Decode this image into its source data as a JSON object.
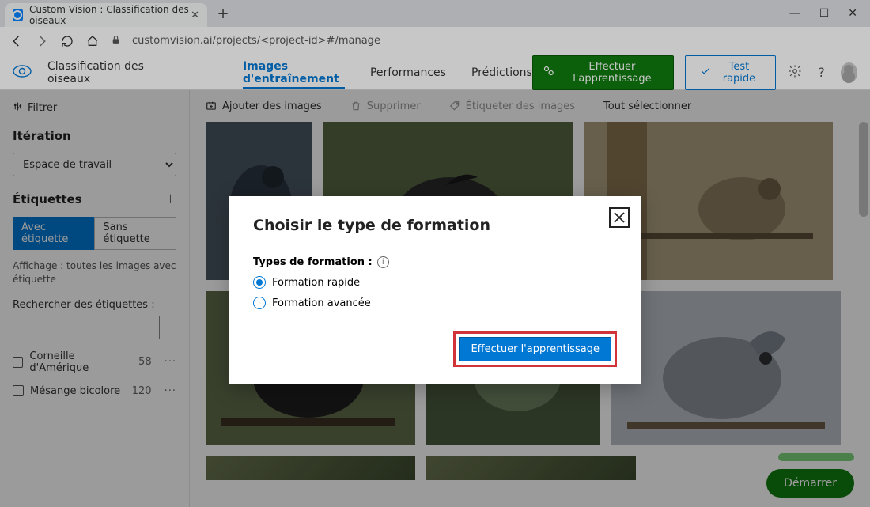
{
  "browser": {
    "tab_title": "Custom Vision : Classification des oiseaux",
    "url": "customvision.ai/projects/<project-id>#/manage"
  },
  "header": {
    "project_title": "Classification des oiseaux",
    "tabs": {
      "training": "Images d'entraînement",
      "performance": "Performances",
      "predictions": "Prédictions"
    },
    "train_button": "Effectuer l'apprentissage",
    "quick_test": "Test rapide"
  },
  "sidebar": {
    "filter": "Filtrer",
    "iteration_heading": "Itération",
    "iteration_value": "Espace de travail",
    "tags_heading": "Étiquettes",
    "tagged": "Avec étiquette",
    "untagged": "Sans étiquette",
    "showing": "Affichage : toutes les images avec étiquette",
    "search_label": "Rechercher des étiquettes :",
    "tags": [
      {
        "name": "Corneille d'Amérique",
        "count": "58"
      },
      {
        "name": "Mésange bicolore",
        "count": "120"
      }
    ]
  },
  "toolbar": {
    "add": "Ajouter des images",
    "delete": "Supprimer",
    "tag": "Étiqueter des images",
    "select_all": "Tout sélectionner"
  },
  "modal": {
    "title": "Choisir le type de formation",
    "types_label": "Types de formation :",
    "option_quick": "Formation rapide",
    "option_advanced": "Formation avancée",
    "submit": "Effectuer l'apprentissage"
  },
  "footer": {
    "start": "Démarrer"
  }
}
